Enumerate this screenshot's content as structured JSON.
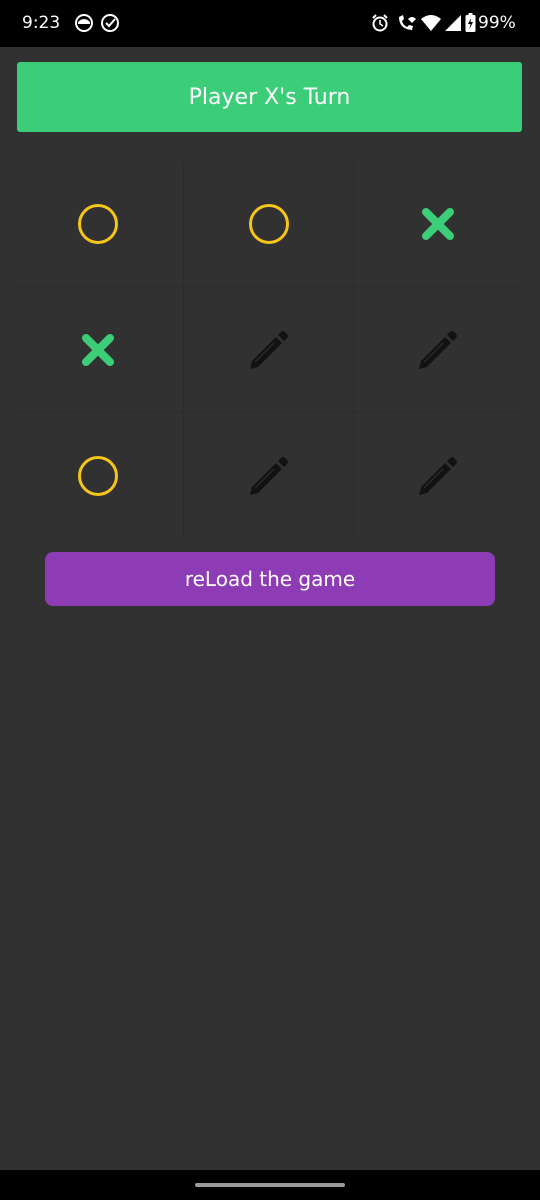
{
  "status_bar": {
    "time": "9:23",
    "battery": "99%",
    "icons": [
      "notification-app-icon",
      "check-circle-icon",
      "alarm-icon",
      "wifi-call-icon",
      "wifi-icon",
      "signal-icon",
      "battery-icon"
    ]
  },
  "header": {
    "turn_text": "Player X's Turn"
  },
  "board": {
    "cells": [
      "O",
      "O",
      "X",
      "X",
      "",
      "",
      "O",
      "",
      ""
    ],
    "empty_cell_icon": "pencil-icon",
    "colors": {
      "x": "#3ccd78",
      "o": "#f5c518",
      "empty": "#121212"
    }
  },
  "actions": {
    "reload_label": "reLoad the game"
  },
  "colors": {
    "background": "#313131",
    "banner": "#3ccd78",
    "reload_button": "#8e3bb6"
  }
}
